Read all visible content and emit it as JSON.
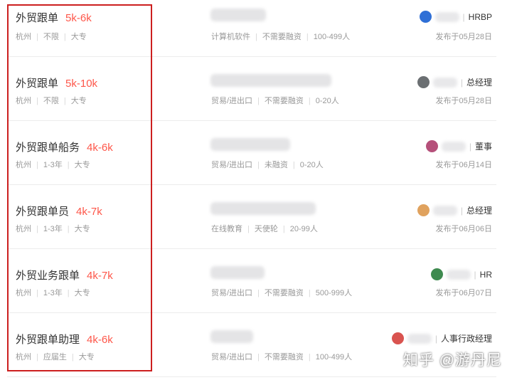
{
  "jobs": [
    {
      "title": "外贸跟单",
      "salary": "5k-6k",
      "meta": [
        "杭州",
        "不限",
        "大专"
      ],
      "company_meta": [
        "计算机软件",
        "不需要融资",
        "100-499人"
      ],
      "recruiter_role": "HRBP",
      "published": "发布于05月28日",
      "avatar_color": "#2f6fd6"
    },
    {
      "title": "外贸跟单",
      "salary": "5k-10k",
      "meta": [
        "杭州",
        "不限",
        "大专"
      ],
      "company_meta": [
        "贸易/进出口",
        "不需要融资",
        "0-20人"
      ],
      "recruiter_role": "总经理",
      "published": "发布于05月28日",
      "avatar_color": "#6b6f72"
    },
    {
      "title": "外贸跟单船务",
      "salary": "4k-6k",
      "meta": [
        "杭州",
        "1-3年",
        "大专"
      ],
      "company_meta": [
        "贸易/进出口",
        "未融资",
        "0-20人"
      ],
      "recruiter_role": "董事",
      "published": "发布于06月14日",
      "avatar_color": "#b5507a"
    },
    {
      "title": "外贸跟单员",
      "salary": "4k-7k",
      "meta": [
        "杭州",
        "1-3年",
        "大专"
      ],
      "company_meta": [
        "在线教育",
        "天使轮",
        "20-99人"
      ],
      "recruiter_role": "总经理",
      "published": "发布于06月06日",
      "avatar_color": "#e0a25e"
    },
    {
      "title": "外贸业务跟单",
      "salary": "4k-7k",
      "meta": [
        "杭州",
        "1-3年",
        "大专"
      ],
      "company_meta": [
        "贸易/进出口",
        "不需要融资",
        "500-999人"
      ],
      "recruiter_role": "HR",
      "published": "发布于06月07日",
      "avatar_color": "#3e8a4f"
    },
    {
      "title": "外贸跟单助理",
      "salary": "4k-6k",
      "meta": [
        "杭州",
        "应届生",
        "大专"
      ],
      "company_meta": [
        "贸易/进出口",
        "不需要融资",
        "100-499人"
      ],
      "recruiter_role": "人事行政经理",
      "published": "",
      "avatar_color": "#d9534f"
    }
  ],
  "watermark": "知乎 @游丹尼"
}
